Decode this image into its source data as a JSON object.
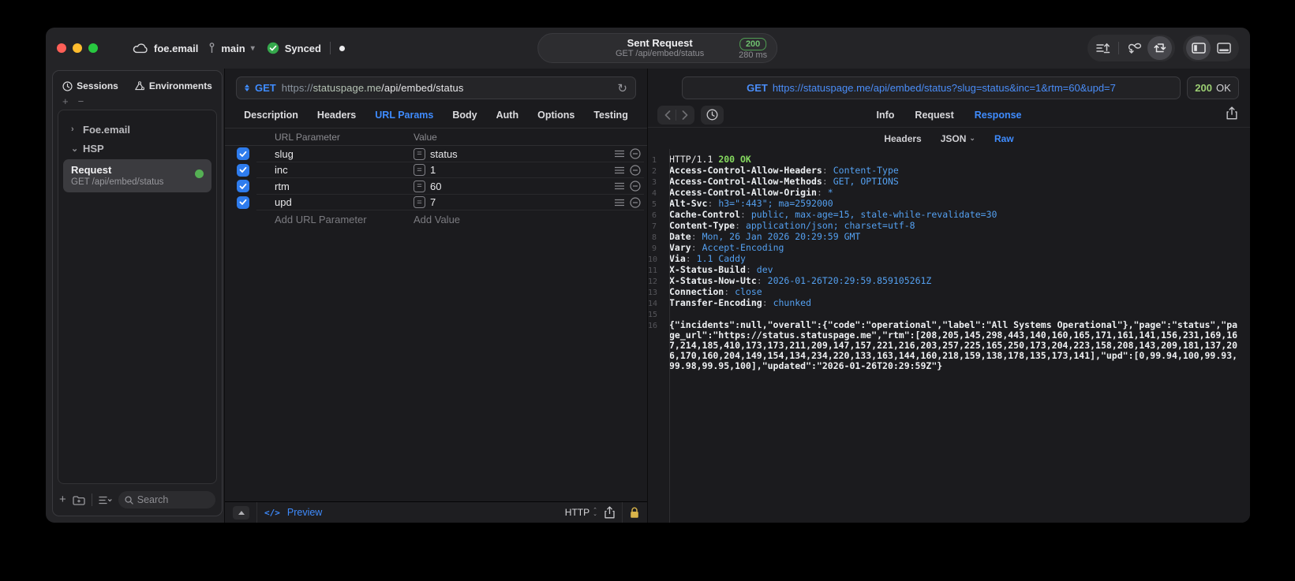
{
  "titlebar": {
    "project": "foe.email",
    "branch": "main",
    "sync_status": "Synced",
    "title": "Sent Request",
    "subtitle": "GET /api/embed/status",
    "status_code": "200",
    "duration": "280 ms"
  },
  "sidebar": {
    "tabs": [
      {
        "label": "Sessions",
        "icon": "clock-icon",
        "active": true
      },
      {
        "label": "Environments",
        "icon": "environments-icon",
        "active": false
      }
    ],
    "groups": [
      {
        "label": "Foe.email",
        "expanded": false
      },
      {
        "label": "HSP",
        "expanded": true
      }
    ],
    "request_item": {
      "title": "Request",
      "subtitle": "GET /api/embed/status",
      "selected": true
    },
    "search_placeholder": "Search"
  },
  "request_pane": {
    "method": "GET",
    "url": {
      "scheme": "https://",
      "host": "statuspage.me",
      "path": "/api/embed/status"
    },
    "tabs": [
      {
        "label": "Description"
      },
      {
        "label": "Headers"
      },
      {
        "label": "URL Params",
        "active": true
      },
      {
        "label": "Body"
      },
      {
        "label": "Auth"
      },
      {
        "label": "Options"
      },
      {
        "label": "Testing"
      }
    ],
    "table": {
      "columns": [
        "URL Parameter",
        "Value"
      ],
      "rows": [
        {
          "name": "slug",
          "value": "status",
          "checked": true
        },
        {
          "name": "inc",
          "value": "1",
          "checked": true
        },
        {
          "name": "rtm",
          "value": "60",
          "checked": true
        },
        {
          "name": "upd",
          "value": "7",
          "checked": true
        }
      ],
      "add_name_placeholder": "Add URL Parameter",
      "add_value_placeholder": "Add Value"
    },
    "footer": {
      "preview_label": "Preview",
      "protocol_label": "HTTP"
    }
  },
  "response_pane": {
    "request_line": {
      "method": "GET",
      "url": "https://statuspage.me/api/embed/status?slug=status&inc=1&rtm=60&upd=7"
    },
    "status": {
      "code": "200",
      "text": "OK"
    },
    "tabs": [
      {
        "label": "Info"
      },
      {
        "label": "Request"
      },
      {
        "label": "Response",
        "active": true
      }
    ],
    "subtabs": [
      {
        "label": "Headers"
      },
      {
        "label": "JSON",
        "dropdown": true
      },
      {
        "label": "Raw",
        "active": true
      }
    ],
    "body_lines": [
      {
        "n": "1",
        "kind": "status",
        "text": "HTTP/1.1 ",
        "highlight": "200 OK"
      },
      {
        "n": "2",
        "kind": "header",
        "name": "Access-Control-Allow-Headers",
        "value": "Content-Type"
      },
      {
        "n": "3",
        "kind": "header",
        "name": "Access-Control-Allow-Methods",
        "value": "GET, OPTIONS"
      },
      {
        "n": "4",
        "kind": "header",
        "name": "Access-Control-Allow-Origin",
        "value": "*"
      },
      {
        "n": "5",
        "kind": "header",
        "name": "Alt-Svc",
        "value": "h3=\":443\"; ma=2592000"
      },
      {
        "n": "6",
        "kind": "header",
        "name": "Cache-Control",
        "value": "public, max-age=15, stale-while-revalidate=30"
      },
      {
        "n": "7",
        "kind": "header",
        "name": "Content-Type",
        "value": "application/json; charset=utf-8"
      },
      {
        "n": "8",
        "kind": "header",
        "name": "Date",
        "value": "Mon, 26 Jan 2026 20:29:59 GMT"
      },
      {
        "n": "9",
        "kind": "header",
        "name": "Vary",
        "value": "Accept-Encoding"
      },
      {
        "n": "10",
        "kind": "header",
        "name": "Via",
        "value": "1.1 Caddy"
      },
      {
        "n": "11",
        "kind": "header",
        "name": "X-Status-Build",
        "value": "dev"
      },
      {
        "n": "12",
        "kind": "header",
        "name": "X-Status-Now-Utc",
        "value": "2026-01-26T20:29:59.859105261Z"
      },
      {
        "n": "13",
        "kind": "header",
        "name": "Connection",
        "value": "close"
      },
      {
        "n": "14",
        "kind": "header",
        "name": "Transfer-Encoding",
        "value": "chunked"
      },
      {
        "n": "15",
        "kind": "blank"
      },
      {
        "n": "16",
        "kind": "json",
        "text": "{\"incidents\":null,\"overall\":{\"code\":\"operational\",\"label\":\"All Systems Operational\"},\"page\":\"status\",\"page_url\":\"https://status.statuspage.me\",\"rtm\":[208,205,145,298,443,140,160,165,171,161,141,156,231,169,167,214,185,410,173,173,211,209,147,157,221,216,203,257,225,165,250,173,204,223,158,208,143,209,181,137,206,170,160,204,149,154,134,234,220,133,163,144,160,218,159,138,178,135,173,141],\"upd\":[0,99.94,100,99.93,99.98,99.95,100],\"updated\":\"2026-01-26T20:29:59Z\"}"
      }
    ]
  },
  "colors": {
    "accent_blue": "#3f8cff",
    "header_value_blue": "#54a0f0",
    "status_green": "#85d95f",
    "badge_green": "#6ec06f",
    "checkbox_blue": "#2e7ced",
    "request_dot_green": "#55b054",
    "lock_yellow": "#d9b44a",
    "traffic_red": "#ff5f57",
    "traffic_yellow": "#febc2e",
    "traffic_green": "#28c840"
  },
  "icons": {
    "cloud-icon": "sync cloud",
    "branch-icon": "git branch",
    "synced-check-icon": "green check circle",
    "chevron-down-icon": "dropdown chevron",
    "record-dot-icon": "white dot",
    "import-lines-icon": "lines with up arrow",
    "loop-sync-icon": "loop with down arrow",
    "send-return-icon": "boxed return arrow",
    "sidebar-panel-icon": "left panel toggle",
    "bottom-panel-icon": "bottom panel toggle",
    "clock-icon": "history clock",
    "environments-icon": "environments triangle",
    "search-icon": "magnifier",
    "plus-icon": "plus",
    "minus-icon": "minus",
    "folder-add-icon": "new folder",
    "list-options-icon": "list with chevron",
    "refresh-icon": "reload arrow",
    "equals-icon": "equals box",
    "reorder-lines-icon": "hamburger lines",
    "remove-circle-icon": "minus in circle",
    "collapse-up-icon": "triangle up",
    "code-icon": "</>",
    "share-icon": "share box arrow",
    "lock-icon": "padlock",
    "back-icon": "chevron left",
    "forward-icon": "chevron right"
  }
}
